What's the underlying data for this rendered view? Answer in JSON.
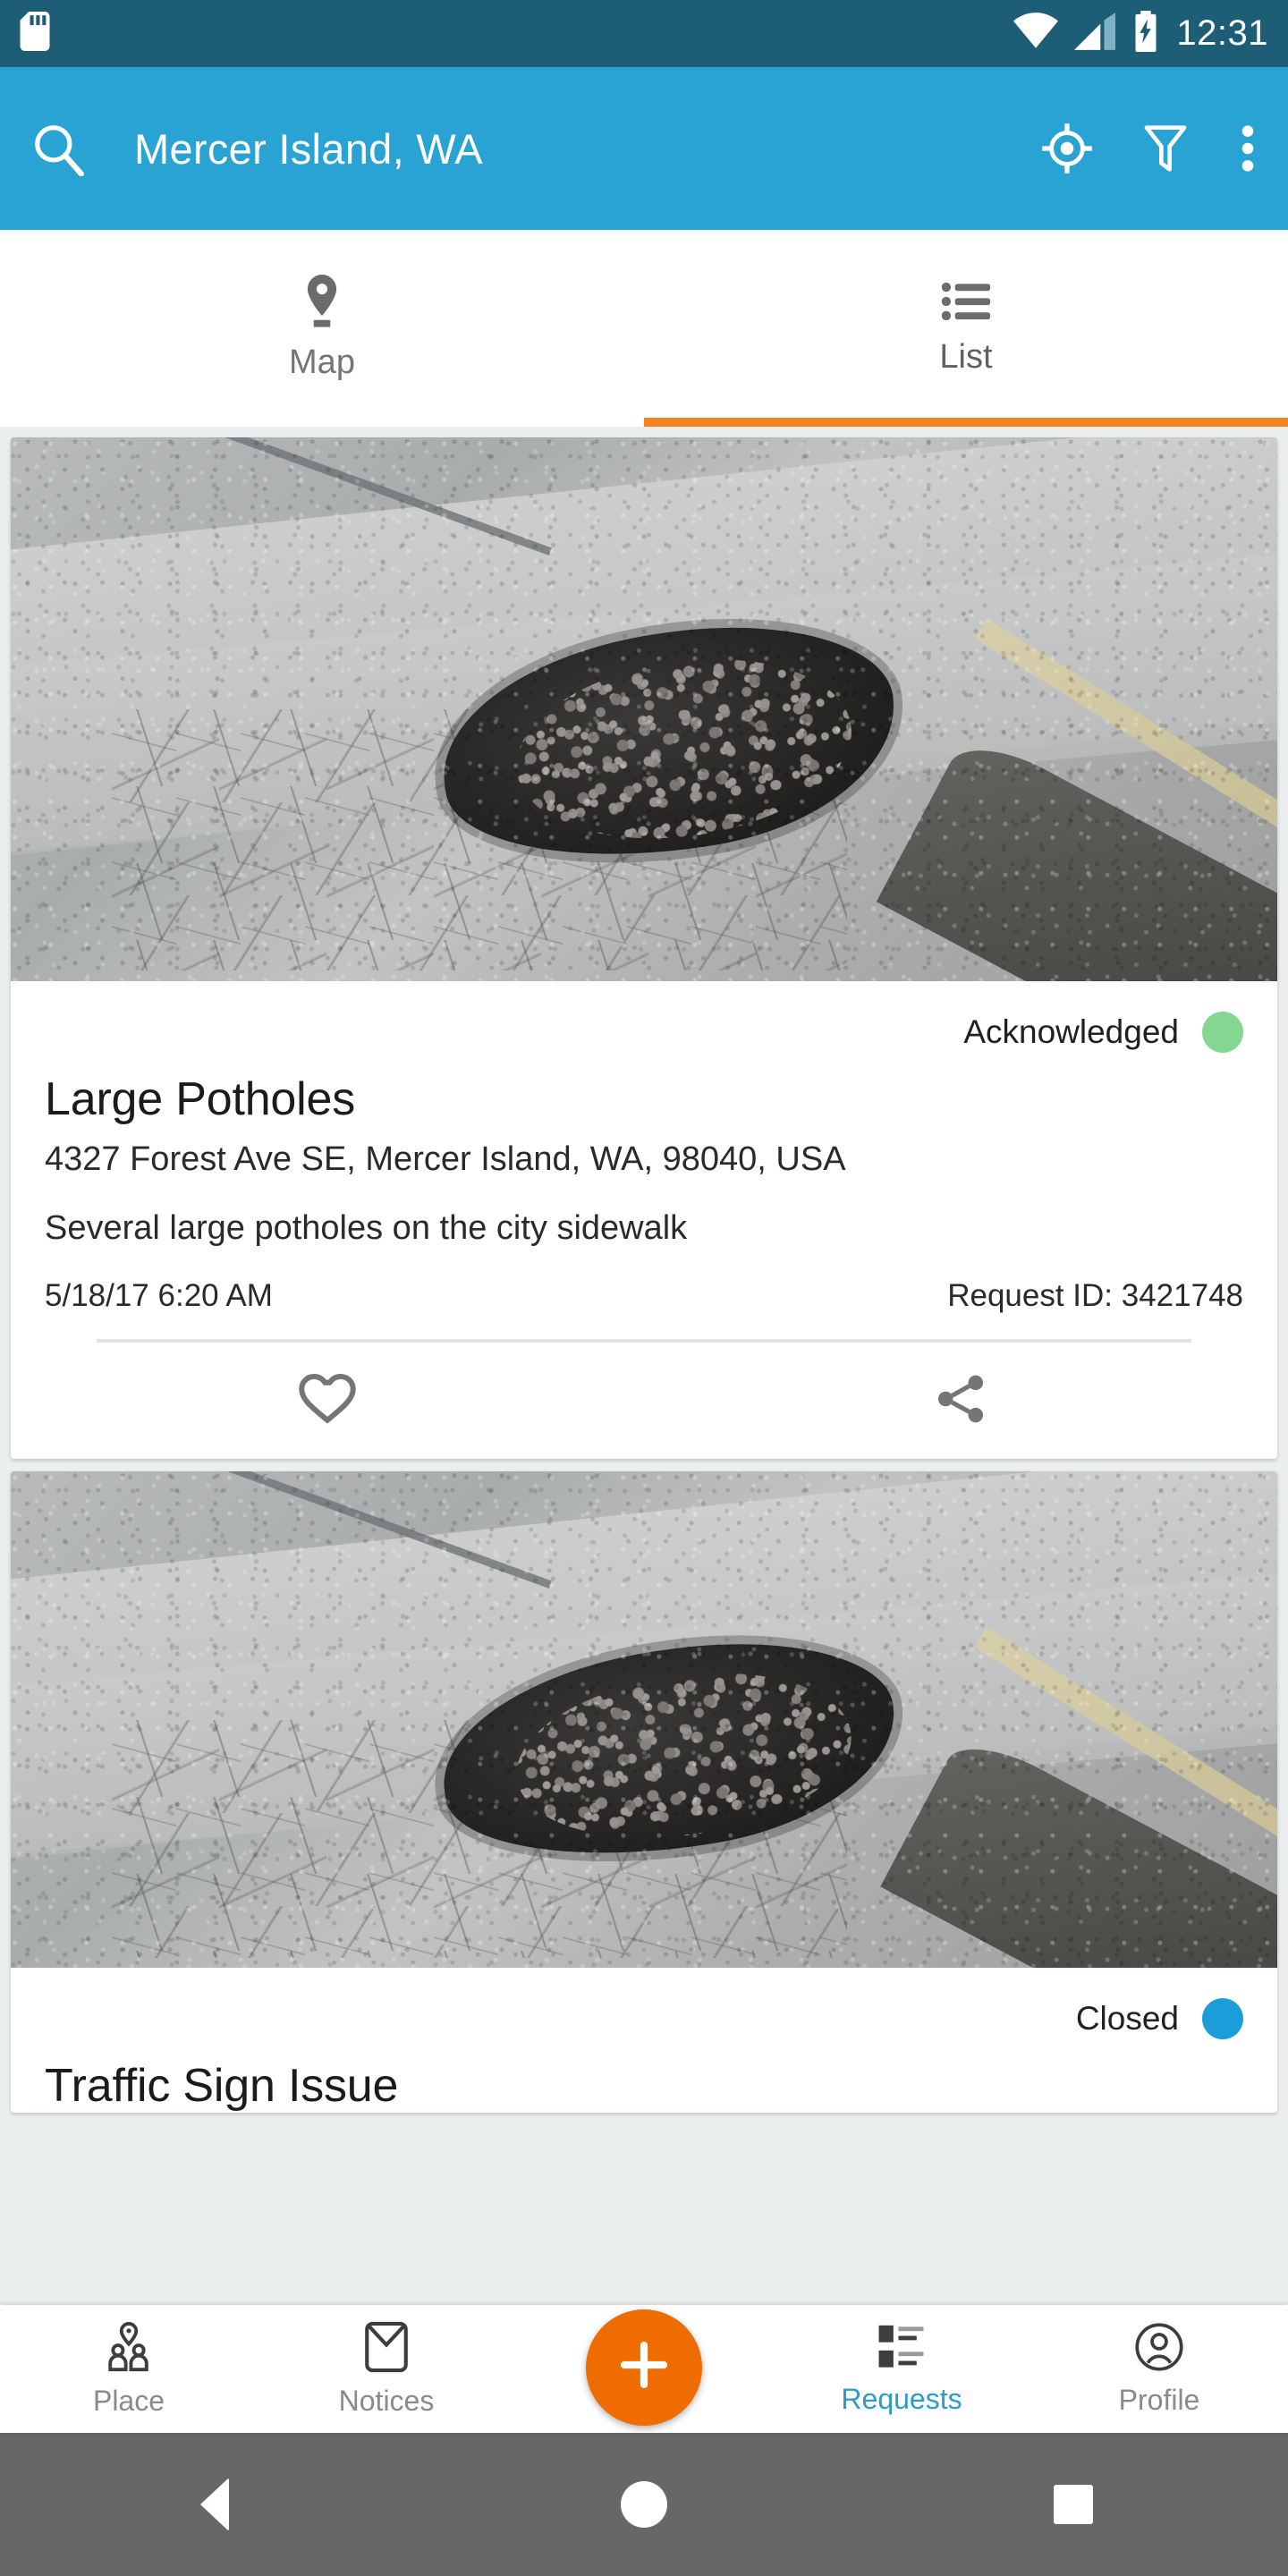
{
  "status_bar": {
    "time": "12:31",
    "icons": [
      "sd-card-icon",
      "wifi-icon",
      "cell-signal-icon",
      "battery-charging-icon"
    ],
    "background": "#1d5d75"
  },
  "app_bar": {
    "title": "Mercer Island, WA",
    "background": "#29a3d4",
    "search_icon": "search-icon",
    "locate_icon": "my-location-icon",
    "filter_icon": "filter-icon",
    "overflow_icon": "more-vertical-icon"
  },
  "tabs": {
    "indicator_color": "#f58220",
    "items": [
      {
        "label": "Map",
        "icon": "map-pin-icon",
        "active": false
      },
      {
        "label": "List",
        "icon": "list-icon",
        "active": true
      }
    ]
  },
  "requests": [
    {
      "status": "Acknowledged",
      "status_color": "#85d690",
      "title": "Large Potholes",
      "address": "4327 Forest Ave SE, Mercer Island, WA, 98040, USA",
      "description": "Several large potholes on the city sidewalk",
      "date": "5/18/17 6:20 AM",
      "request_id": "Request ID: 3421748",
      "like_icon": "heart-icon",
      "share_icon": "share-icon"
    },
    {
      "status": "Closed",
      "status_color": "#1b9dd9",
      "title": "Traffic Sign Issue"
    }
  ],
  "bottom_nav": {
    "active_color": "#2d9cc8",
    "fab_color": "#ef6c00",
    "fab_icon": "plus-icon",
    "items": [
      {
        "label": "Place",
        "icon": "place-people-icon",
        "active": false
      },
      {
        "label": "Notices",
        "icon": "envelope-icon",
        "active": false
      },
      {
        "label": "Requests",
        "icon": "requests-list-icon",
        "active": true
      },
      {
        "label": "Profile",
        "icon": "profile-icon",
        "active": false
      }
    ]
  },
  "android_nav": {
    "back": "back-triangle-icon",
    "home": "home-circle-icon",
    "recents": "recents-square-icon"
  }
}
